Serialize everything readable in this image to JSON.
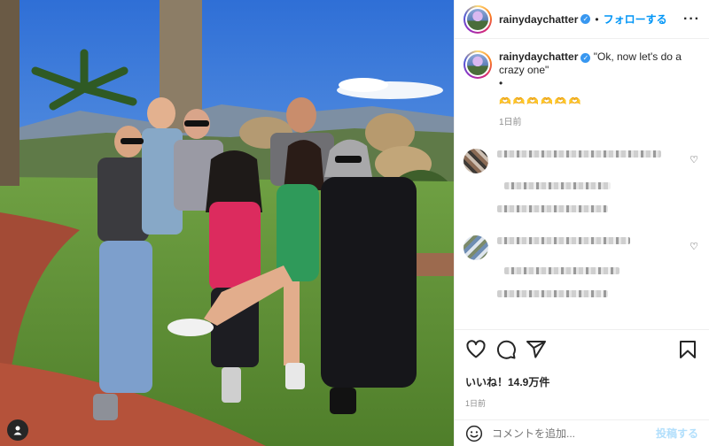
{
  "header": {
    "username": "rainydaychatter",
    "separator": "•",
    "follow_label": "フォローする",
    "more_icon": "more-horizontal-icon"
  },
  "caption": {
    "username": "rainydaychatter",
    "text": "\"Ok, now let's do a crazy one\"",
    "bullet": "•",
    "emoji": "🫶🫶🫶🫶🫶🫶",
    "time": "1日前"
  },
  "comments": [
    {
      "avatar": "blurred",
      "lines": 3
    },
    {
      "avatar": "blurred",
      "lines": 3
    }
  ],
  "actions": {
    "likes": "いいね！14.9万件",
    "date": "1日前"
  },
  "composer": {
    "placeholder": "コメントを追加...",
    "post_label": "投稿する"
  },
  "colors": {
    "accent": "#0095f6",
    "verified": "#3897f0",
    "post_disabled": "#b2dffc"
  }
}
